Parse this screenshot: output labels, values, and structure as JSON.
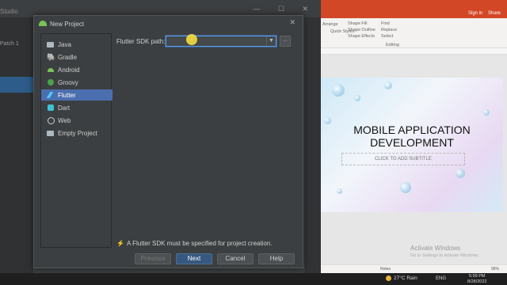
{
  "ide": {
    "title_fragment": "Studio",
    "side_item": "Patch 1",
    "window_controls": "— ☐ ✕"
  },
  "dialog": {
    "title": "New Project",
    "close": "✕",
    "project_types": [
      {
        "label": "Java",
        "icon": "folder-icon"
      },
      {
        "label": "Gradle",
        "icon": "gradle-icon"
      },
      {
        "label": "Android",
        "icon": "android-icon"
      },
      {
        "label": "Groovy",
        "icon": "groovy-icon"
      },
      {
        "label": "Flutter",
        "icon": "flutter-icon"
      },
      {
        "label": "Dart",
        "icon": "dart-icon"
      },
      {
        "label": "Web",
        "icon": "globe-icon"
      },
      {
        "label": "Empty Project",
        "icon": "folder-icon"
      }
    ],
    "selected": "Flutter",
    "sdk_label": "Flutter SDK path:",
    "sdk_value": "",
    "browse_label": "...",
    "warning": "A Flutter SDK must be specified for project creation.",
    "buttons": {
      "previous": "Previous",
      "next": "Next",
      "cancel": "Cancel",
      "help": "Help"
    }
  },
  "ppt": {
    "signin": "Sign in",
    "share": "Share",
    "ribbon": {
      "shape_fill": "Shape Fill",
      "shape_outline": "Shape Outline",
      "shape_effects": "Shape Effects",
      "quick_styles": "Quick Styles",
      "arrange": "Arrange",
      "find": "Find",
      "replace": "Replace",
      "select": "Select",
      "editing": "Editing"
    },
    "slide_title_line1": "MOBILE APPLICATION",
    "slide_title_line2": "DEVELOPMENT",
    "slide_subtitle": "CLICK TO ADD SUBTITLE",
    "activate_title": "Activate Windows",
    "activate_sub": "Go to Settings to activate Windows.",
    "notes": "Notes",
    "zoom": "96%"
  },
  "taskbar": {
    "weather": "27°C  Rain",
    "lang": "ENG",
    "time": "5:59 PM",
    "date": "8/28/2022"
  },
  "colors": {
    "accent": "#4b6eaf",
    "primary_button": "#365880",
    "office": "#d24726",
    "flutter": "#54c5f8"
  }
}
